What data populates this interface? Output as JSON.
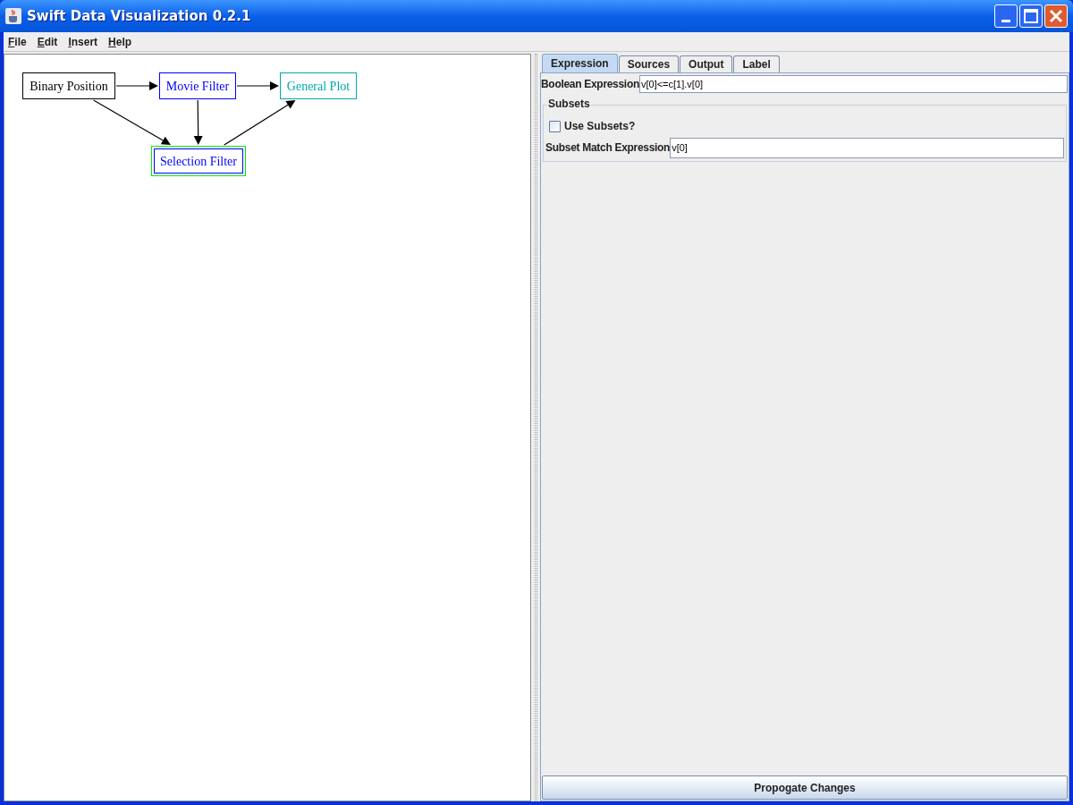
{
  "window": {
    "title": "Swift Data Visualization 0.2.1"
  },
  "menu": [
    "File",
    "Edit",
    "Insert",
    "Help"
  ],
  "graph": {
    "nodes": [
      {
        "label": "Binary Position",
        "color": "#000000",
        "selected": false
      },
      {
        "label": "Movie Filter",
        "color": "#0000ff",
        "selected": false
      },
      {
        "label": "General Plot",
        "color": "#00a8a8",
        "selected": false
      },
      {
        "label": "Selection Filter",
        "color": "#0000ff",
        "selected": true
      }
    ]
  },
  "tabs": [
    {
      "label": "Expression",
      "selected": true
    },
    {
      "label": "Sources",
      "selected": false
    },
    {
      "label": "Output",
      "selected": false
    },
    {
      "label": "Label",
      "selected": false
    }
  ],
  "boolean_expression": {
    "label": "Boolean Expression",
    "value": "v[0]<=c[1].v[0]"
  },
  "subsets": {
    "title": "Subsets",
    "use_subsets": {
      "label": "Use Subsets?",
      "checked": false
    },
    "match_expression": {
      "label": "Subset Match Expression",
      "value": "v[0]"
    }
  },
  "propagate_button": "Propogate Changes"
}
